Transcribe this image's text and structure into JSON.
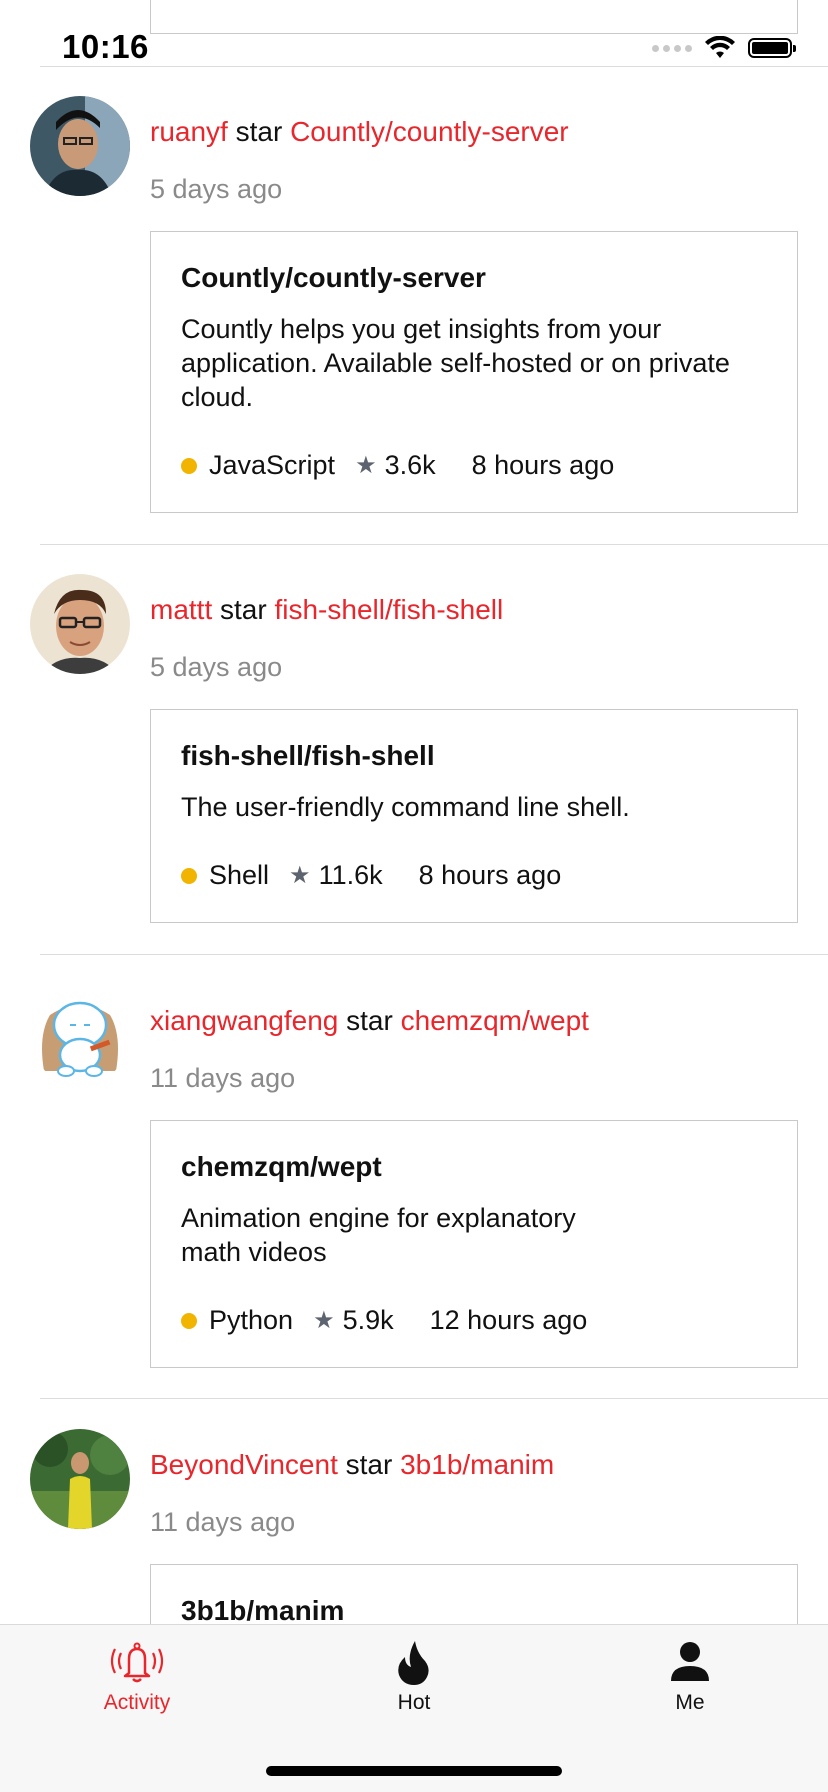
{
  "status_bar": {
    "time": "10:16"
  },
  "feed": [
    {
      "user": "ruanyf",
      "action": "star",
      "repo": "Countly/countly-server",
      "time": "5 days ago",
      "card": {
        "title": "Countly/countly-server",
        "description": "Countly helps you get insights from your application. Available self-hosted or on private cloud.",
        "language": "JavaScript",
        "stars": "3.6k",
        "updated": "8 hours ago"
      }
    },
    {
      "user": "mattt",
      "action": "star",
      "repo": "fish-shell/fish-shell",
      "time": "5 days ago",
      "card": {
        "title": "fish-shell/fish-shell",
        "description": "The user-friendly command line shell.",
        "language": "Shell",
        "stars": "11.6k",
        "updated": "8 hours ago"
      }
    },
    {
      "user": "xiangwangfeng",
      "action": "star",
      "repo": "chemzqm/wept",
      "time": "11 days ago",
      "card": {
        "title": "chemzqm/wept",
        "description": "Animation engine for explanatory math videos",
        "language": "Python",
        "stars": "5.9k",
        "updated": "12 hours ago"
      }
    },
    {
      "user": "BeyondVincent",
      "action": "star",
      "repo": "3b1b/manim",
      "time": "11 days ago",
      "card": {
        "title": "3b1b/manim"
      }
    }
  ],
  "tabbar": {
    "tabs": [
      {
        "label": "Activity",
        "icon": "bell-icon",
        "active": true
      },
      {
        "label": "Hot",
        "icon": "flame-icon",
        "active": false
      },
      {
        "label": "Me",
        "icon": "person-icon",
        "active": false
      }
    ]
  },
  "colors": {
    "accent": "#e8262b",
    "language_dot": "#f1b400",
    "secondary_text": "#8a8a8a"
  }
}
